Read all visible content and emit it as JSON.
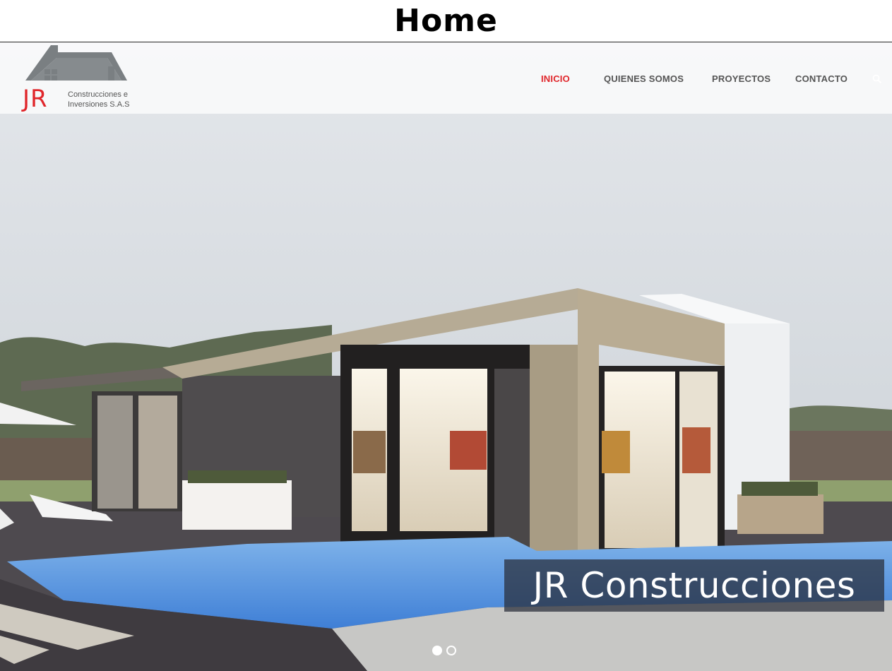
{
  "page": {
    "title": "Home"
  },
  "logo": {
    "mark": "JR",
    "line1": "Construcciones e",
    "line2": "Inversiones S.A.S"
  },
  "nav": {
    "items": [
      {
        "label": "INICIO",
        "active": true
      },
      {
        "label": "QUIENES SOMOS",
        "active": false
      },
      {
        "label": "PROYECTOS",
        "active": false
      },
      {
        "label": "CONTACTO",
        "active": false
      }
    ],
    "search_icon": "search-icon"
  },
  "slider": {
    "caption": "JR Construcciones",
    "slide_count": 2,
    "active_slide": 1
  },
  "colors": {
    "accent": "#e0262b",
    "nav_text": "#555555",
    "caption_bg": "#2c3340"
  }
}
